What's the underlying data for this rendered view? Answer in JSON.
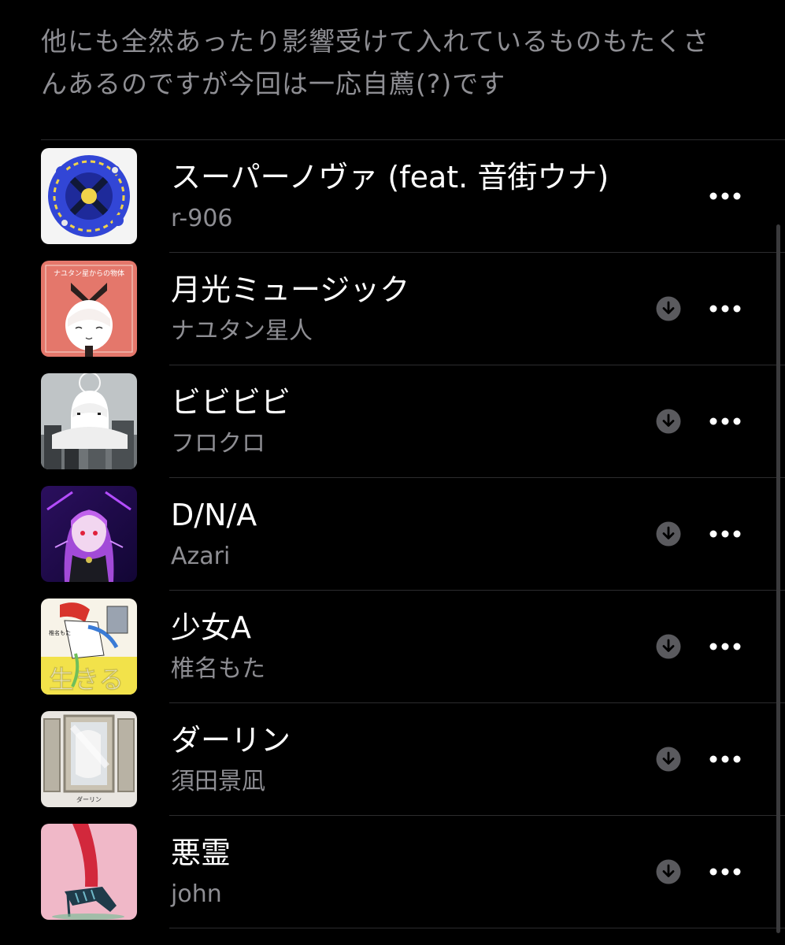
{
  "description": "他にも全然あったり影響受けて入れているものもたくさんあるのですが今回は一応自薦(?)です",
  "tracks": [
    {
      "title": "スーパーノヴァ (feat. 音街ウナ)",
      "artist": "r-906",
      "downloadable": false,
      "artwork": "artwork-blue-illustration"
    },
    {
      "title": "月光ミュージック",
      "artist": "ナユタン星人",
      "downloadable": true,
      "artwork": "artwork-nayutan-planet"
    },
    {
      "title": "ビビビビ",
      "artist": "フロクロ",
      "downloadable": true,
      "artwork": "artwork-monochrome-city"
    },
    {
      "title": "D/N/A",
      "artist": "Azari",
      "downloadable": true,
      "artwork": "artwork-purple-girl"
    },
    {
      "title": "少女A",
      "artist": "椎名もた",
      "downloadable": true,
      "artwork": "artwork-ikiru-yellow"
    },
    {
      "title": "ダーリン",
      "artist": "須田景凪",
      "downloadable": true,
      "artwork": "artwork-frames"
    },
    {
      "title": "悪霊",
      "artist": "john",
      "downloadable": true,
      "artwork": "artwork-red-heel"
    }
  ],
  "artwork_text": {
    "nayutan": "ナユタン星からの物体",
    "shiina_name": "椎名もた",
    "ikiru": "生きる",
    "darling": "ダーリン"
  },
  "icons": {
    "download": "download-circle-icon",
    "more": "more-ellipsis-icon"
  },
  "colors": {
    "background": "#000000",
    "primary_text": "#ffffff",
    "secondary_text": "#8e8e93",
    "separator": "#2c2c2e",
    "icon_gray": "#5a5a5e"
  }
}
